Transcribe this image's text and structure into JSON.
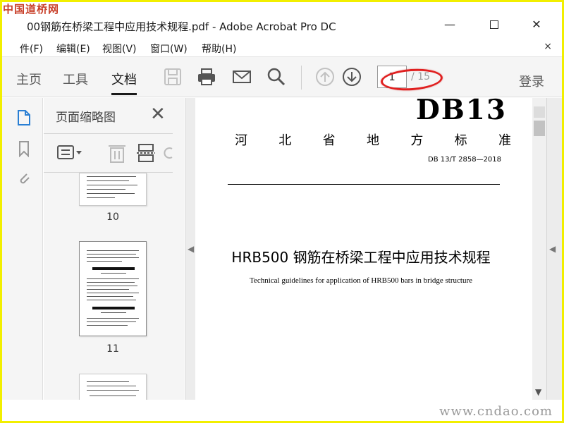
{
  "watermarks": {
    "top_left": "中国道桥网",
    "bottom_right": "www.cndao.com"
  },
  "window": {
    "title": "00钢筋在桥梁工程中应用技术规程.pdf - Adobe Acrobat Pro DC",
    "minimize": "—",
    "close": "✕"
  },
  "menu": {
    "items": [
      "件(F)",
      "编辑(E)",
      "视图(V)",
      "窗口(W)",
      "帮助(H)"
    ],
    "close": "×"
  },
  "toolbar": {
    "tabs": [
      "主页",
      "工具",
      "文档"
    ],
    "active_tab": "文档",
    "page_current": "1",
    "page_total": "/ 15",
    "login": "登录"
  },
  "thumb_panel": {
    "title": "页面缩略图",
    "close": "✕",
    "pages": [
      "10",
      "11"
    ]
  },
  "document": {
    "code": "DB13",
    "province_chars": [
      "河",
      "北",
      "省",
      "地",
      "方",
      "标",
      "准"
    ],
    "standard_no": "DB 13/T  2858—2018",
    "title": "HRB500 钢筋在桥梁工程中应用技术规程",
    "subtitle": "Technical guidelines for application of HRB500 bars in bridge structure"
  },
  "colors": {
    "highlight_ellipse": "#e02020",
    "frame": "#f2ef00",
    "watermark_red": "#c8402a"
  }
}
